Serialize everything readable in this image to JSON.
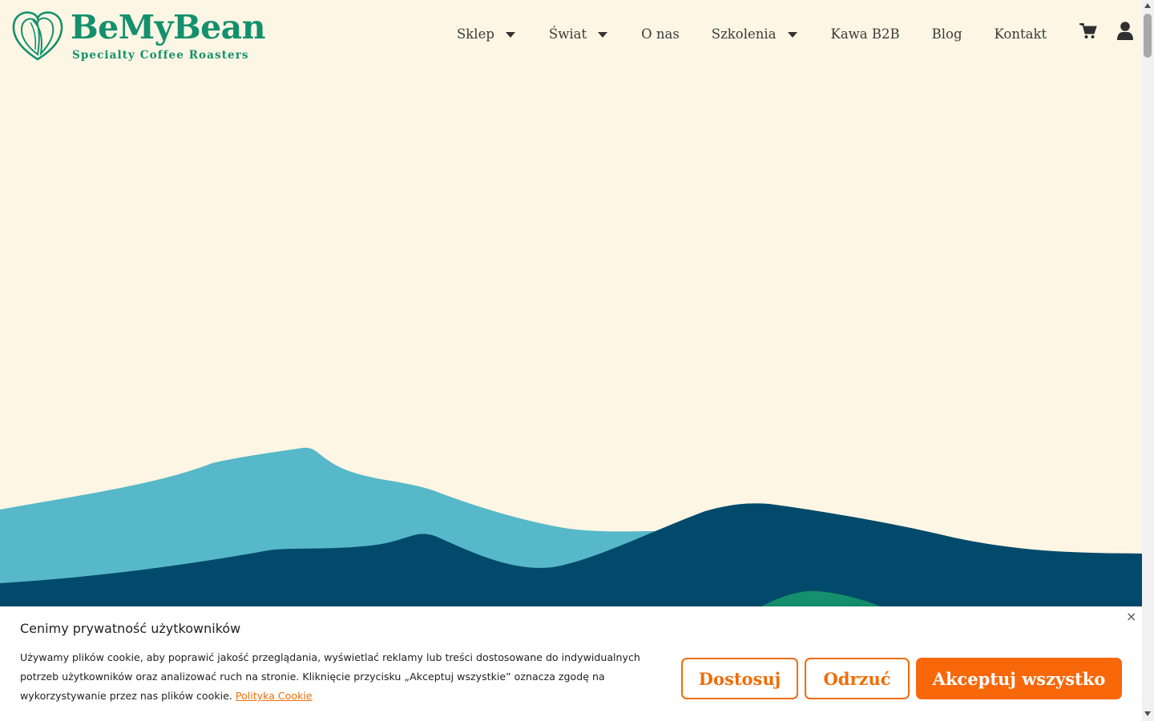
{
  "brand": {
    "name": "BeMyBean",
    "tagline": "Specialty Coffee Roasters",
    "color": "#14906e"
  },
  "nav": {
    "items": [
      {
        "label": "Sklep",
        "has_dropdown": true
      },
      {
        "label": "Świat",
        "has_dropdown": true
      },
      {
        "label": "O nas",
        "has_dropdown": false
      },
      {
        "label": "Szkolenia",
        "has_dropdown": true
      },
      {
        "label": "Kawa B2B",
        "has_dropdown": false
      },
      {
        "label": "Blog",
        "has_dropdown": false
      },
      {
        "label": "Kontakt",
        "has_dropdown": false
      }
    ],
    "icons": [
      "cart-icon",
      "user-icon"
    ]
  },
  "hero": {
    "background": "#fdf6e4",
    "hill_colors": [
      "#56b8c8",
      "#024a6b",
      "#14906e"
    ]
  },
  "cookie": {
    "title": "Cenimy prywatność użytkowników",
    "text": "Używamy plików cookie, aby poprawić jakość przeglądania, wyświetlać reklamy lub treści dostosowane do indywidualnych potrzeb użytkowników oraz analizować ruch na stronie. Kliknięcie przycisku „Akceptuj wszystkie” oznacza zgodę na wykorzystywanie przez nas plików cookie.",
    "link": "Polityka Cookie",
    "close": "×",
    "buttons": {
      "customize": "Dostosuj",
      "reject": "Odrzuć",
      "accept": "Akceptuj wszystko"
    },
    "accent": "#f06d0a"
  }
}
